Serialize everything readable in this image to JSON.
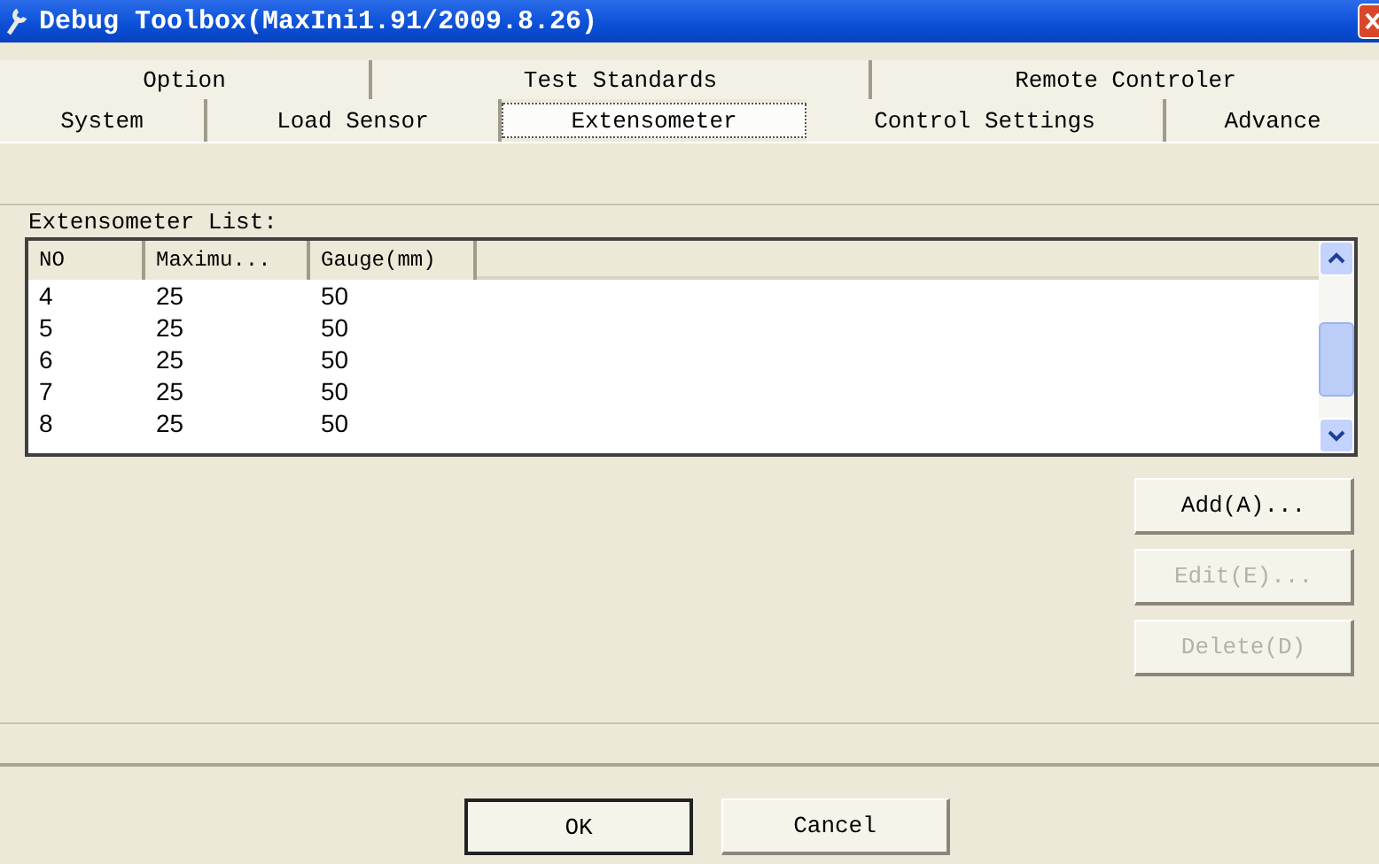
{
  "window": {
    "title": "Debug Toolbox(MaxIni1.91/2009.8.26)"
  },
  "tab_rows": [
    [
      {
        "label": "Option",
        "selected": false
      },
      {
        "label": "Test Standards",
        "selected": false
      },
      {
        "label": "Remote Controler",
        "selected": false
      }
    ],
    [
      {
        "label": "System",
        "selected": false
      },
      {
        "label": "Load Sensor",
        "selected": false
      },
      {
        "label": "Extensometer",
        "selected": true
      },
      {
        "label": "Control Settings",
        "selected": false
      },
      {
        "label": "Advance",
        "selected": false
      }
    ]
  ],
  "list": {
    "label": "Extensometer List:",
    "columns": [
      "NO",
      "Maximu...",
      "Gauge(mm)"
    ],
    "rows": [
      [
        "4",
        "25",
        "50"
      ],
      [
        "5",
        "25",
        "50"
      ],
      [
        "6",
        "25",
        "50"
      ],
      [
        "7",
        "25",
        "50"
      ],
      [
        "8",
        "25",
        "50"
      ]
    ]
  },
  "side_buttons": [
    {
      "label": "Add(A)...",
      "disabled": false
    },
    {
      "label": "Edit(E)...",
      "disabled": true
    },
    {
      "label": "Delete(D)",
      "disabled": true
    }
  ],
  "buttons": [
    {
      "label": "OK",
      "default": true
    },
    {
      "label": "Cancel",
      "default": false
    }
  ]
}
